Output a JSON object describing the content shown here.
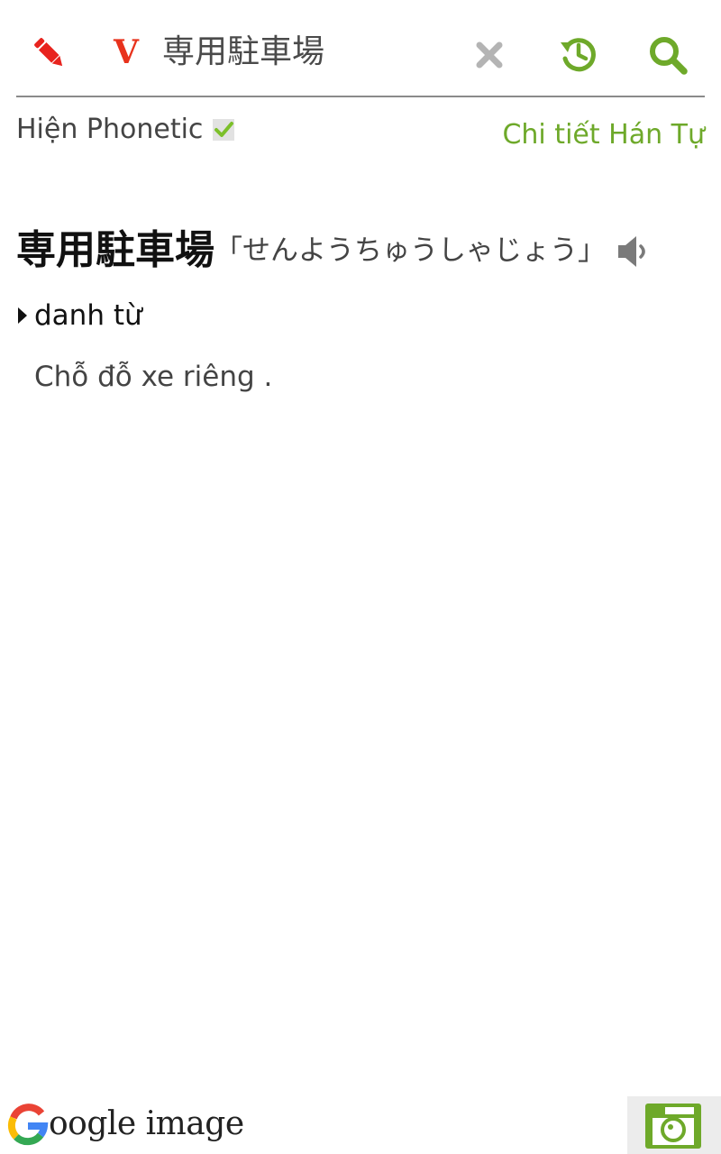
{
  "topbar": {
    "edit_icon": "pencil-icon",
    "dictionary_badge": "V",
    "search_value": "専用駐車場",
    "clear_icon": "close-icon",
    "history_icon": "history-icon",
    "search_icon": "search-icon"
  },
  "options": {
    "phonetic_label": "Hiện Phonetic",
    "phonetic_checked": true,
    "kanji_detail_link": "Chi tiết Hán Tự"
  },
  "entry": {
    "word": "専用駐車場",
    "reading": "「せんようちゅうしゃじょう」",
    "speaker_icon": "speaker-icon",
    "part_of_speech": "danh từ",
    "meaning": "Chỗ đỗ xe riêng ."
  },
  "bottom": {
    "google_image_label": "oogle image",
    "camera_icon": "camera-icon"
  },
  "colors": {
    "accent_green": "#6ea92a",
    "badge_red": "#e8321c",
    "pencil_red": "#e8231e"
  }
}
